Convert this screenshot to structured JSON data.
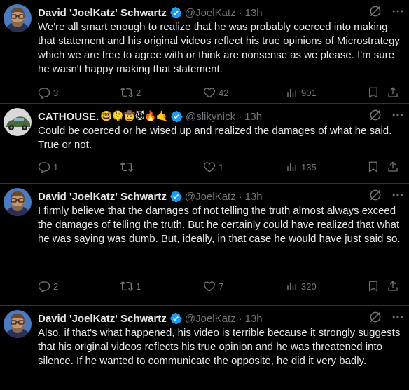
{
  "tweets": [
    {
      "name": "David 'JoelKatz' Schwartz",
      "name_emoji": "",
      "handle": "@JoelKatz",
      "dot": "·",
      "time": "13h",
      "text": "We're all smart enough to realize that he was probably coerced into making that statement and his original videos reflect his true opinions of Microstrategy which we are free to agree with or think are nonsense as we please. I'm sure he wasn't happy making that statement.",
      "replies": "3",
      "retweets": "2",
      "likes": "42",
      "views": "901"
    },
    {
      "name": "CATHOUSE.",
      "name_emoji": "🤓🫠🤠😈🔥🤙",
      "handle": "@slikynick",
      "dot": "·",
      "time": "13h",
      "text": "Could be coerced or he wised up and realized the damages of what he said. True or not.",
      "replies": "1",
      "retweets": "",
      "likes": "1",
      "views": "135"
    },
    {
      "name": "David 'JoelKatz' Schwartz",
      "name_emoji": "",
      "handle": "@JoelKatz",
      "dot": "·",
      "time": "13h",
      "text": "I firmly believe that the damages of not telling the truth almost always exceed the damages of telling the truth. But he certainly could have realized that what he was saying was dumb. But, ideally, in that case he would have just said so.",
      "replies": "2",
      "retweets": "1",
      "likes": "7",
      "views": "320"
    },
    {
      "name": "David 'JoelKatz' Schwartz",
      "name_emoji": "",
      "handle": "@JoelKatz",
      "dot": "·",
      "time": "13h",
      "text": "Also, if that's what happened, his video is terrible because it strongly suggests that his original videos reflects his true opinion and he was threatened into silence. If he wanted to communicate the opposite, he did it very badly."
    }
  ],
  "colors": {
    "accent": "#1d9bf0",
    "muted": "#71767b",
    "text": "#e7e9ea",
    "border": "#2f3336"
  }
}
